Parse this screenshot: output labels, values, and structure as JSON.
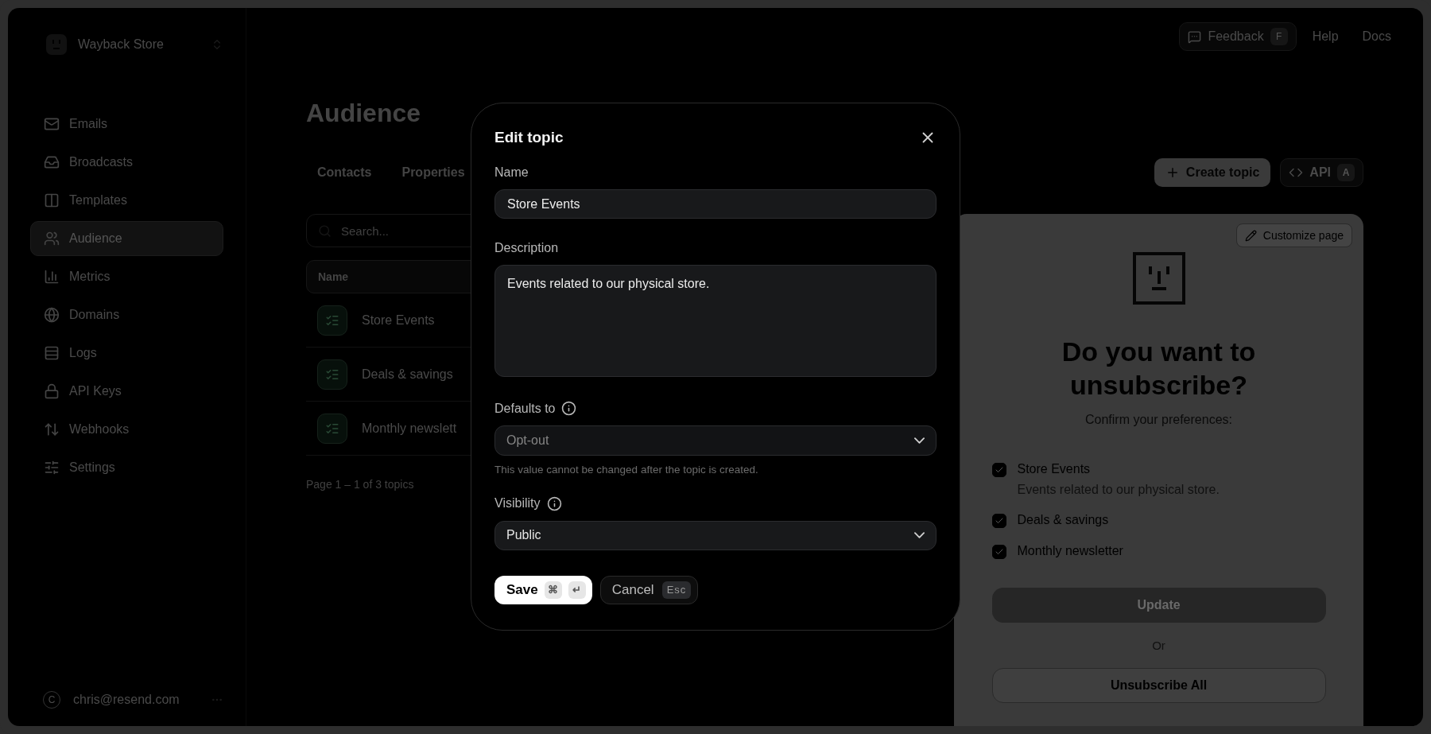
{
  "workspace": {
    "name": "Wayback Store"
  },
  "sidebar": {
    "items": [
      {
        "label": "Emails",
        "selected": false
      },
      {
        "label": "Broadcasts",
        "selected": false
      },
      {
        "label": "Templates",
        "selected": false
      },
      {
        "label": "Audience",
        "selected": true
      },
      {
        "label": "Metrics",
        "selected": false
      },
      {
        "label": "Domains",
        "selected": false
      },
      {
        "label": "Logs",
        "selected": false
      },
      {
        "label": "API Keys",
        "selected": false
      },
      {
        "label": "Webhooks",
        "selected": false
      },
      {
        "label": "Settings",
        "selected": false
      }
    ],
    "user": {
      "initial": "C",
      "email": "chris@resend.com"
    }
  },
  "topbar": {
    "feedback": {
      "label": "Feedback",
      "shortcut": "F"
    },
    "links": [
      "Help",
      "Docs"
    ]
  },
  "page": {
    "title": "Audience",
    "tabs": [
      {
        "label": "Contacts",
        "selected": false
      },
      {
        "label": "Properties",
        "selected": false
      }
    ],
    "create_button": "Create topic",
    "api_button": {
      "label": "API",
      "shortcut": "A"
    }
  },
  "search": {
    "placeholder": "Search..."
  },
  "table": {
    "columns": [
      "Name"
    ],
    "rows": [
      {
        "name": "Store Events"
      },
      {
        "name": "Deals & savings"
      },
      {
        "name": "Monthly newslett"
      }
    ],
    "footer": "Page 1 – 1 of 3 topics"
  },
  "preview": {
    "customize_button": "Customize page",
    "heading": "Do you want to unsubscribe?",
    "subheading": "Confirm your preferences:",
    "topics": [
      {
        "title": "Store Events",
        "description": "Events related to our physical store.",
        "checked": true
      },
      {
        "title": "Deals & savings",
        "checked": true
      },
      {
        "title": "Monthly newsletter",
        "checked": true
      }
    ],
    "update_button": "Update",
    "separator": "Or",
    "unsubscribe_button": "Unsubscribe All"
  },
  "dialog": {
    "title": "Edit topic",
    "name": {
      "label": "Name",
      "value": "Store Events"
    },
    "description": {
      "label": "Description",
      "value": "Events related to our physical store."
    },
    "defaults": {
      "label": "Defaults to",
      "value": "Opt-out",
      "disabled": true,
      "hint": "This value cannot be changed after the topic is created."
    },
    "visibility": {
      "label": "Visibility",
      "value": "Public",
      "disabled": false
    },
    "save": {
      "label": "Save",
      "keys": [
        "⌘",
        "↵"
      ]
    },
    "cancel": {
      "label": "Cancel",
      "key": "Esc"
    }
  }
}
